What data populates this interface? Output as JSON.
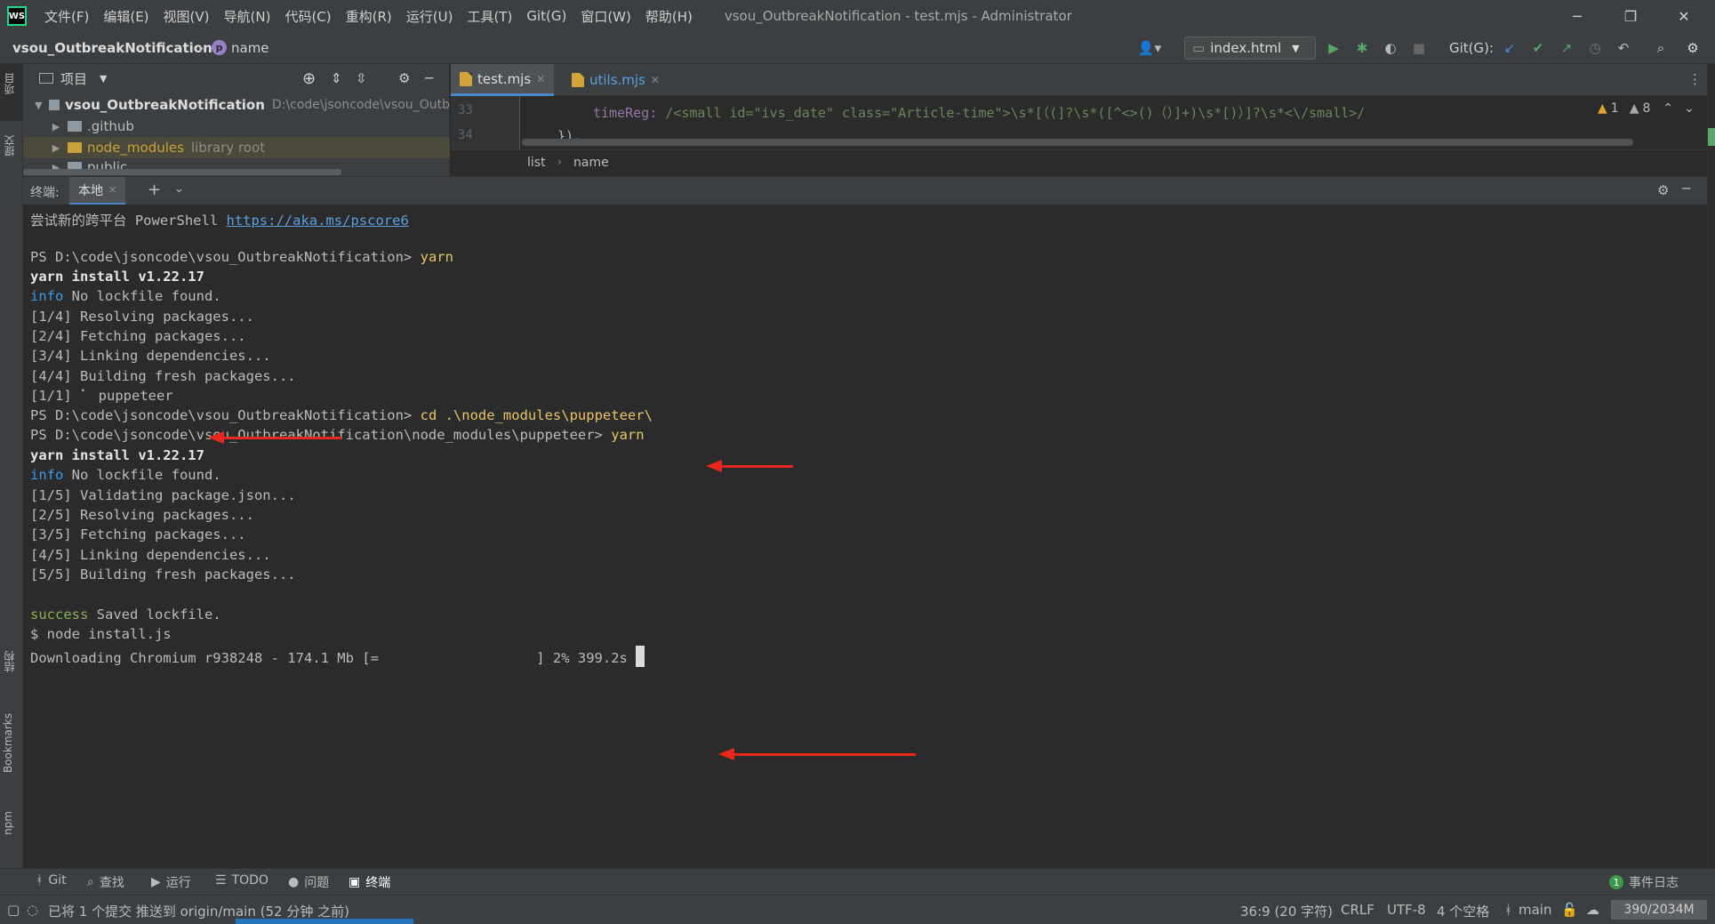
{
  "window": {
    "menu": [
      "文件(F)",
      "编辑(E)",
      "视图(V)",
      "导航(N)",
      "代码(C)",
      "重构(R)",
      "运行(U)",
      "工具(T)",
      "Git(G)",
      "窗口(W)",
      "帮助(H)"
    ],
    "title": "vsou_OutbreakNotification - test.mjs - Administrator",
    "logo_text": "WS"
  },
  "navbar": {
    "project": "vsou_OutbreakNotification",
    "symbol_badge": "p",
    "symbol": "name",
    "run_config": "index.html",
    "git_label": "Git(G):"
  },
  "left_stripe": {
    "project": "项目",
    "commit": "提交",
    "structure": "结构",
    "bookmarks": "Bookmarks",
    "npm": "npm"
  },
  "project_panel": {
    "header": "项目",
    "root_name": "vsou_OutbreakNotification",
    "root_path": "D:\\code\\jsoncode\\vsou_Outb",
    "items": [
      {
        "name": ".github",
        "note": ""
      },
      {
        "name": "node_modules",
        "note": "library root"
      },
      {
        "name": "public",
        "note": ""
      }
    ]
  },
  "editor": {
    "tabs": [
      {
        "label": "test.mjs",
        "active": true
      },
      {
        "label": "utils.mjs",
        "active": false
      }
    ],
    "lines": [
      {
        "num": "33",
        "key": "timeReg: ",
        "value": "/<small id=\"ivs_date\" class=\"Article-time\">\\s*[（(]?\\s*([^<>()（）]+)\\s*[)）]?\\s*<\\/small>/"
      },
      {
        "num": "34",
        "key": "}),",
        "value": ""
      }
    ],
    "warnings": "1",
    "weak_warnings": "8",
    "breadcrumb": [
      "list",
      "name"
    ]
  },
  "terminal": {
    "label": "终端:",
    "tab": "本地",
    "lines": {
      "l0_text": "尝试新的跨平台 PowerShell ",
      "l0_link": "https://aka.ms/pscore6",
      "l1_prompt": "PS D:\\code\\jsoncode\\vsou_OutbreakNotification> ",
      "l1_cmd": "yarn",
      "l2": "yarn install v1.22.17",
      "l3_tag": "info",
      "l3_text": " No lockfile found.",
      "l4": "[1/4] Resolving packages...",
      "l5": "[2/4] Fetching packages...",
      "l6": "[3/4] Linking dependencies...",
      "l7": "[4/4] Building fresh packages...",
      "l8": "[1/1] ⠁ puppeteer",
      "l9_prompt": "PS D:\\code\\jsoncode\\vsou_OutbreakNotification> ",
      "l9_cmd": "cd .\\node_modules\\puppeteer\\",
      "l10_prompt": "PS D:\\code\\jsoncode\\vsou_OutbreakNotification\\node_modules\\puppeteer> ",
      "l10_cmd": "yarn",
      "l11": "yarn install v1.22.17",
      "l12_tag": "info",
      "l12_text": " No lockfile found.",
      "l13": "[1/5] Validating package.json...",
      "l14": "[2/5] Resolving packages...",
      "l15": "[3/5] Fetching packages...",
      "l16": "[4/5] Linking dependencies...",
      "l17": "[5/5] Building fresh packages...",
      "l18_tag": "success",
      "l18_text": " Saved lockfile.",
      "l19": "$ node install.js",
      "l20": "Downloading Chromium r938248 - 174.1 Mb [=                   ] 2% 399.2s "
    }
  },
  "tool_windows": [
    "Git",
    "查找",
    "运行",
    "TODO",
    "问题",
    "终端"
  ],
  "event_log": {
    "count": "1",
    "label": "事件日志"
  },
  "status": {
    "message": "已将 1 个提交 推送到 origin/main (52 分钟 之前)",
    "position": "36:9 (20 字符)",
    "line_sep": "CRLF",
    "encoding": "UTF-8",
    "indent": "4 个空格",
    "branch": "main",
    "memory": "390/2034M"
  },
  "colors": {
    "accent": "#4a88c7",
    "annotation": "#e8281e"
  }
}
